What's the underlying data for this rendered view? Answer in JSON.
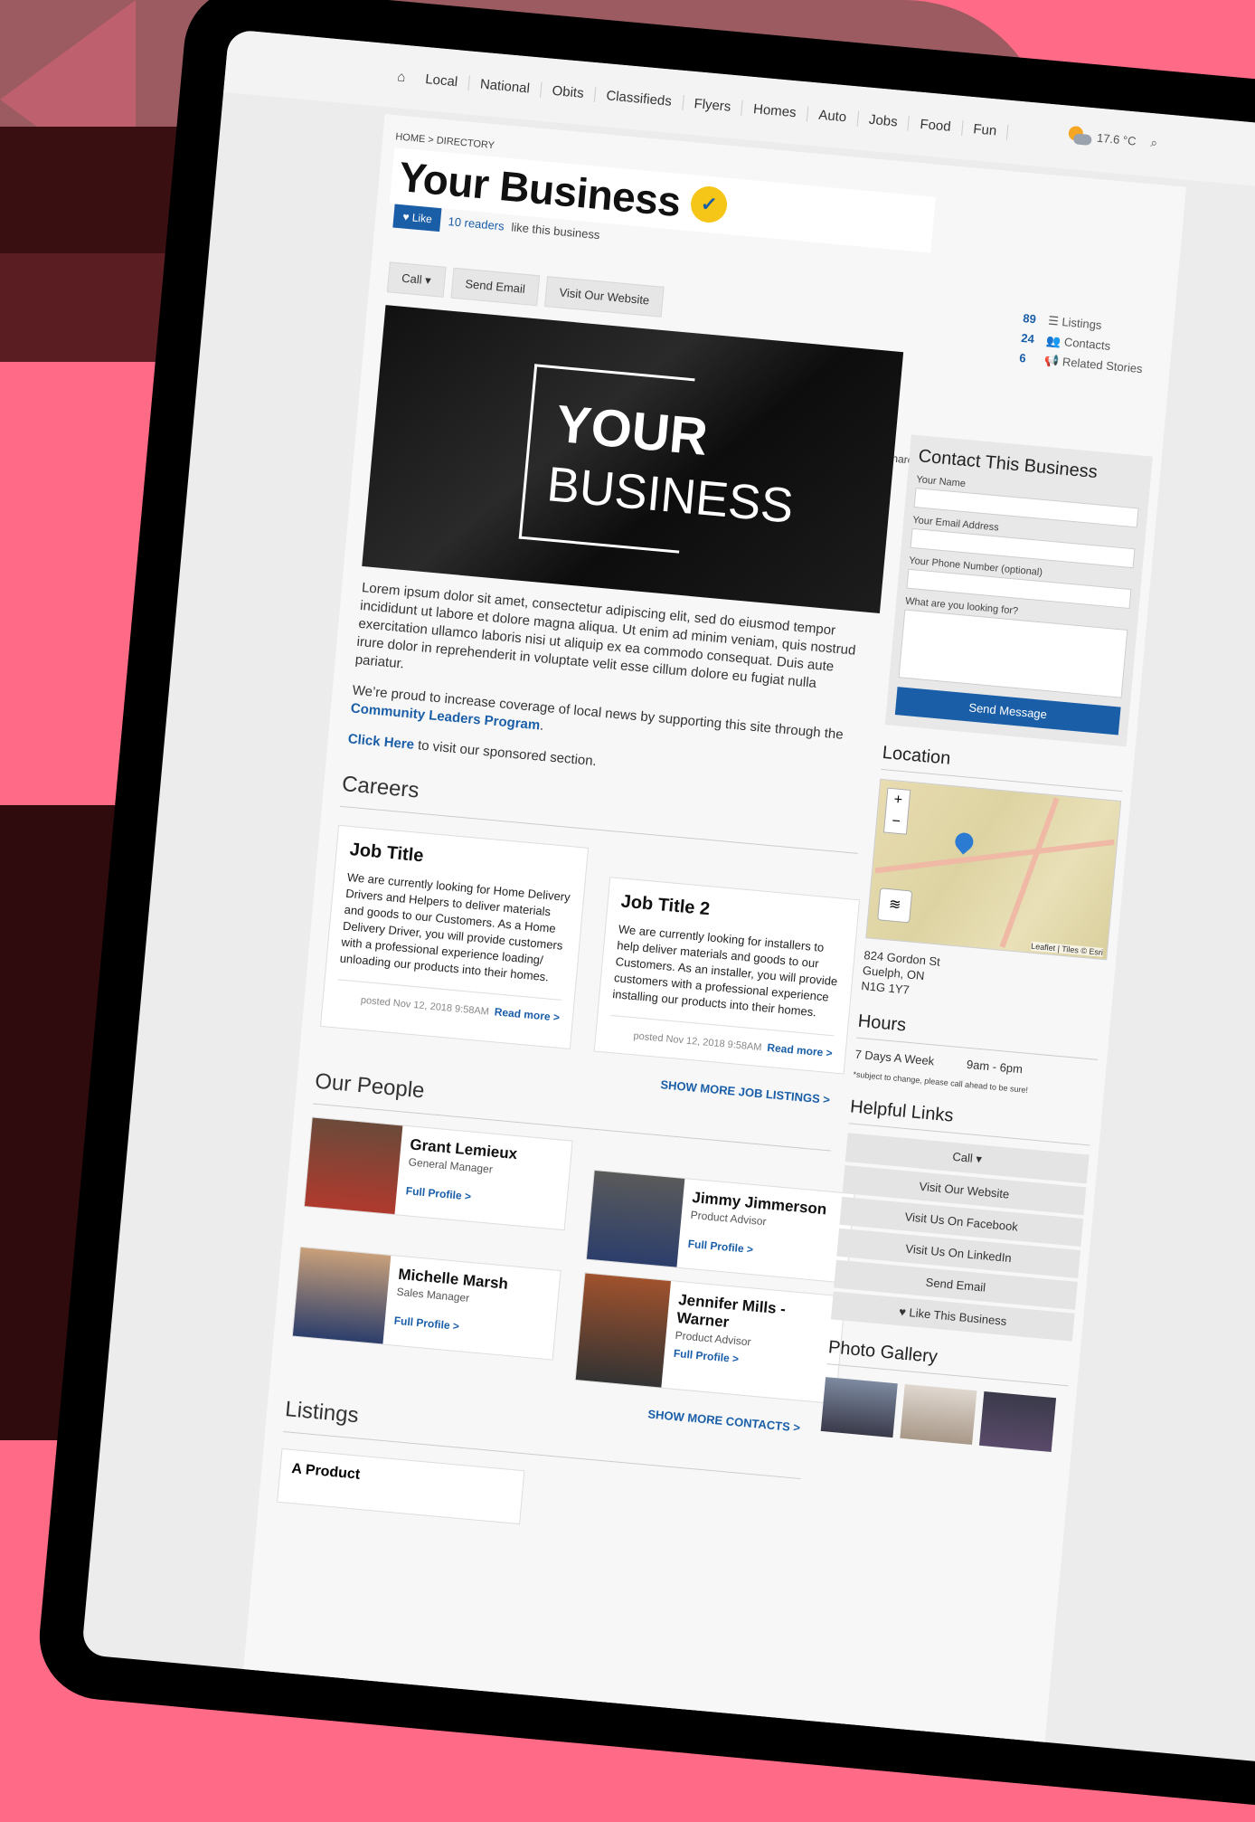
{
  "nav": {
    "items": [
      "Local",
      "National",
      "Obits",
      "Classifieds",
      "Flyers",
      "Homes",
      "Auto",
      "Jobs",
      "Food",
      "Fun"
    ],
    "weather": "17.6 °C"
  },
  "breadcrumb": "HOME > DIRECTORY",
  "business": {
    "title": "Your Business",
    "like_label": "Like",
    "readers": "10 readers",
    "readers_suffix": "like this business"
  },
  "stats": [
    {
      "num": "89",
      "label": "Listings"
    },
    {
      "num": "24",
      "label": "Contacts"
    },
    {
      "num": "6",
      "label": "Related Stories"
    }
  ],
  "actions": [
    "Call ▾",
    "Send Email",
    "Visit Our Website"
  ],
  "share_label": "Share:",
  "hero": {
    "line1": "YOUR",
    "line2": "BUSINESS"
  },
  "description": {
    "para1": "Lorem ipsum dolor sit amet, consectetur adipiscing elit, sed do eiusmod tempor incididunt ut labore et dolore magna aliqua. Ut enim ad minim veniam, quis nostrud exercitation ullamco laboris nisi ut aliquip ex ea commodo consequat. Duis aute irure dolor in reprehenderit in voluptate velit esse cillum dolore eu fugiat nulla pariatur.",
    "para2_prefix": "We’re proud to increase coverage of local news by supporting this site through the",
    "para2_link": "Community Leaders Program",
    "para3_link": "Click Here",
    "para3_suffix": "to visit our sponsored section."
  },
  "careers": {
    "title": "Careers",
    "jobs": [
      {
        "title": "Job Title",
        "text": "We are currently looking for Home Delivery Drivers and Helpers to deliver materials and goods to our Customers. As a Home Delivery Driver, you will provide customers with a professional experience loading/ unloading our products into their homes.",
        "posted": "posted Nov 12, 2018 9:58AM",
        "read_more": "Read more >"
      },
      {
        "title": "Job Title 2",
        "text": "We are currently looking for installers to help deliver materials and goods to our Customers. As an installer, you will provide customers with a professional experience installing our products into their homes.",
        "posted": "posted Nov 12, 2018 9:58AM",
        "read_more": "Read more >"
      }
    ],
    "show_more": "SHOW MORE JOB LISTINGS >"
  },
  "people": {
    "title": "Our People",
    "list": [
      {
        "name": "Grant Lemieux",
        "role": "General Manager",
        "link": "Full Profile >"
      },
      {
        "name": "Jimmy Jimmerson",
        "role": "Product Advisor",
        "link": "Full Profile >"
      },
      {
        "name": "Michelle Marsh",
        "role": "Sales Manager",
        "link": "Full Profile >"
      },
      {
        "name": "Jennifer Mills - Warner",
        "role": "Product Advisor",
        "link": "Full Profile >"
      }
    ],
    "show_more": "SHOW MORE CONTACTS >"
  },
  "listings": {
    "title": "Listings",
    "first": "A Product"
  },
  "contact": {
    "title": "Contact This Business",
    "name_label": "Your Name",
    "email_label": "Your Email Address",
    "phone_label": "Your Phone Number (optional)",
    "message_label": "What are you looking for?",
    "send": "Send Message"
  },
  "location": {
    "title": "Location",
    "attribution": "Leaflet | Tiles © Esri",
    "address": [
      "824 Gordon St",
      "Guelph, ON",
      "N1G 1Y7"
    ]
  },
  "hours": {
    "title": "Hours",
    "days": "7 Days A Week",
    "time": "9am - 6pm",
    "note": "*subject to change, please call ahead to be sure!"
  },
  "helpful": {
    "title": "Helpful Links",
    "links": [
      "Call ▾",
      "Visit Our Website",
      "Visit Us On Facebook",
      "Visit Us On LinkedIn",
      "Send Email",
      "♥ Like This Business"
    ]
  },
  "gallery": {
    "title": "Photo Gallery"
  },
  "colors": {
    "accent": "#1a5ea8",
    "background": "#ff6b86",
    "badge": "#f5c518"
  }
}
